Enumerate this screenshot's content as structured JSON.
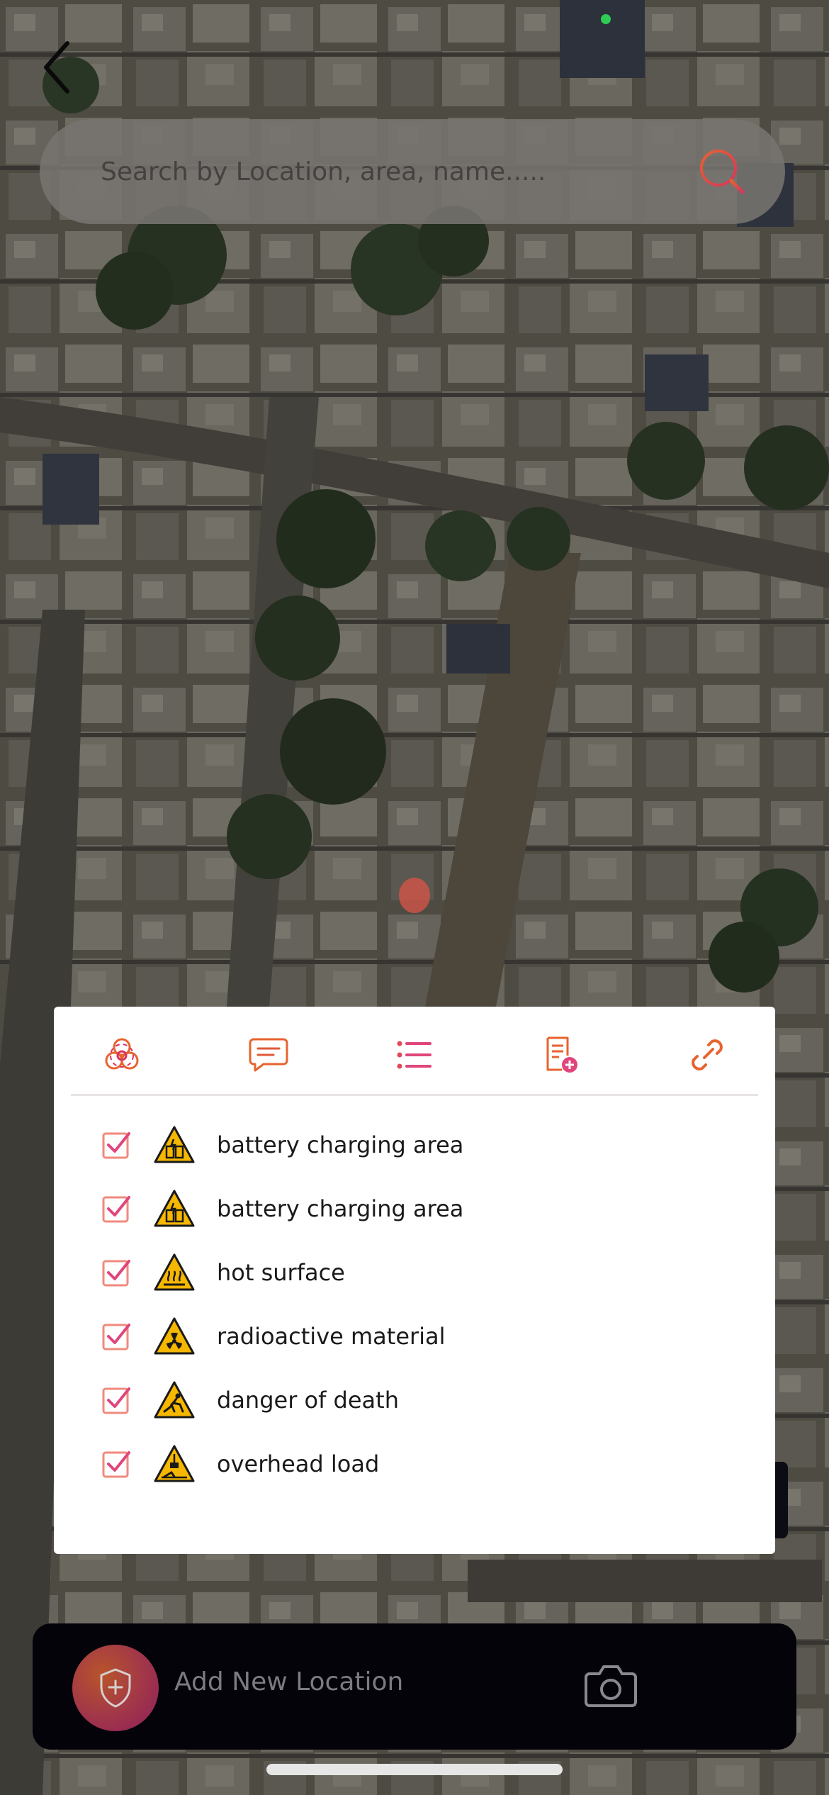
{
  "search": {
    "placeholder": "Search by Location, area, name....."
  },
  "tabs": [
    {
      "name": "hazards",
      "icon": "biohazard-icon",
      "active": true
    },
    {
      "name": "messages",
      "icon": "chat-icon"
    },
    {
      "name": "list",
      "icon": "list-icon"
    },
    {
      "name": "add-note",
      "icon": "note-add-icon"
    },
    {
      "name": "link",
      "icon": "link-icon"
    }
  ],
  "hazards": [
    {
      "label": "battery charging area",
      "checked": true,
      "icon": "battery-charging-warning-icon"
    },
    {
      "label": "battery charging area",
      "checked": true,
      "icon": "battery-charging-warning-icon"
    },
    {
      "label": "hot surface",
      "checked": true,
      "icon": "hot-surface-warning-icon"
    },
    {
      "label": "radioactive material",
      "checked": true,
      "icon": "radioactive-warning-icon"
    },
    {
      "label": "danger of death",
      "checked": true,
      "icon": "danger-of-death-warning-icon"
    },
    {
      "label": "overhead load",
      "checked": true,
      "icon": "overhead-load-warning-icon"
    }
  ],
  "bottom_bar": {
    "add_location_label": "Add New Location"
  },
  "colors": {
    "accent": "#e8632e",
    "accent_pink": "#e0457b",
    "warning_yellow": "#f5b700",
    "panel_bg": "#ffffff",
    "bottom_bar_bg": "#04030a"
  }
}
